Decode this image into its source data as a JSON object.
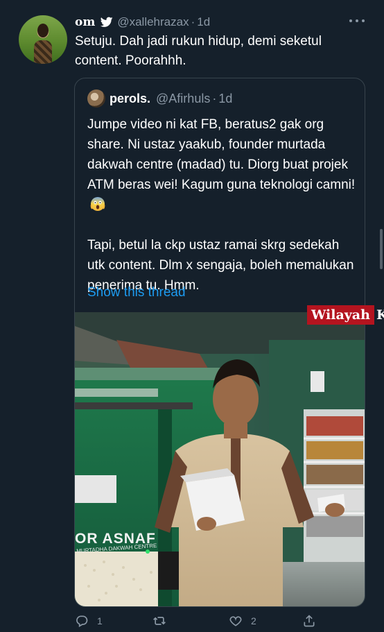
{
  "tweet": {
    "display_name": "om",
    "handle": "@xallehrazax",
    "separator": "·",
    "time": "1d",
    "text": "Setuju. Dah jadi rukun hidup, demi seketul content. Poorahhh."
  },
  "quote": {
    "display_name": "perols.",
    "handle": "@Afirhuls",
    "separator": "·",
    "time": "1d",
    "paragraph_1": "Jumpe video ni kat FB, beratus2 gak org share. Ni ustaz yaakub, founder murtada dakwah centre (madad) tu. Diorg buat projek ATM beras wei! Kagum guna teknologi camni!",
    "paragraph_2": "Tapi, betul la ckp ustaz ramai skrg sedekah utk content. Dlm x sengaja, boleh memalukan penerima tu. Hmm.",
    "show_thread": "Show this thread",
    "media_sign_text": "OR ASNAF",
    "media_sign_subtext": "MURTADHA DAKWAH CENTRE"
  },
  "watermark": {
    "text": "Wilayah",
    "trailing": "K"
  },
  "actions": {
    "reply_count": "1",
    "retweet_count": "",
    "like_count": "2"
  },
  "colors": {
    "background": "#15202b",
    "accent": "#1d9bf0",
    "muted": "#8b98a5",
    "border": "#38444d",
    "watermark_bg": "#b4141f"
  }
}
